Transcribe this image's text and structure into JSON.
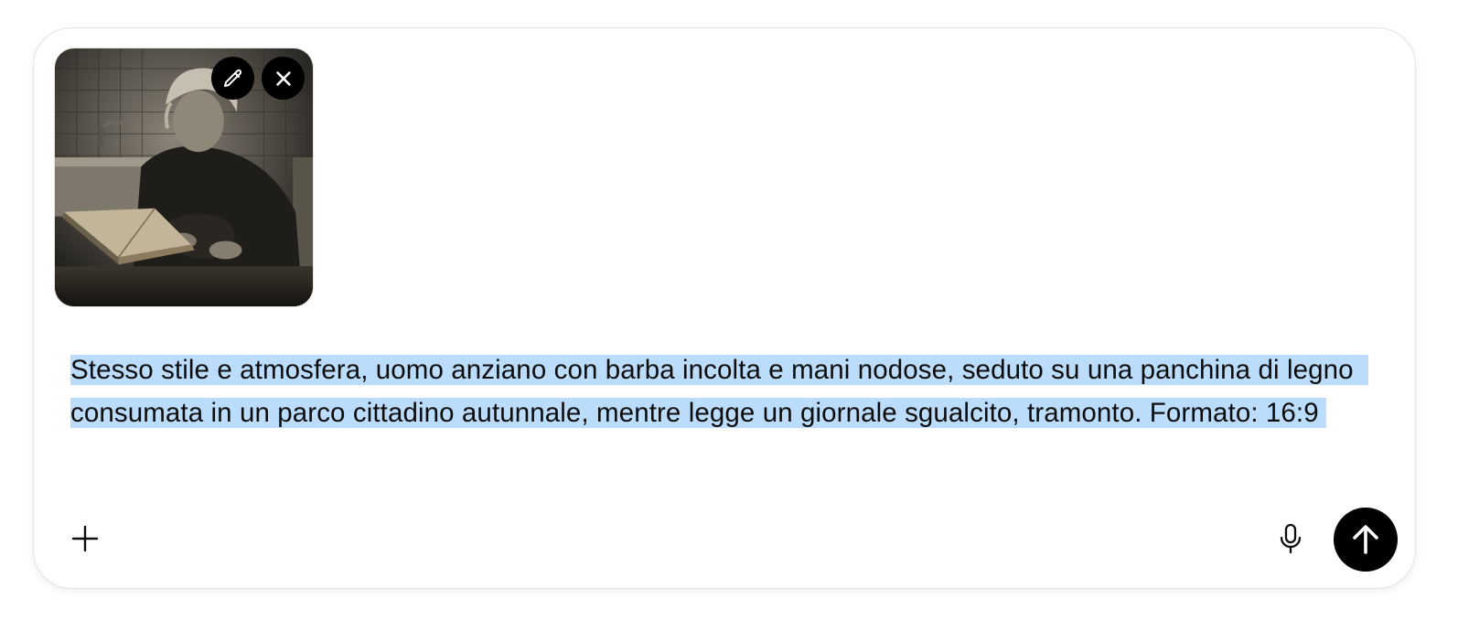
{
  "composer": {
    "attachment": {
      "alt": "Elderly woman reading a book at a kitchen table, sepia photograph",
      "edit_icon": "pencil-icon",
      "remove_icon": "close-icon"
    },
    "prompt_text": "Stesso stile e atmosfera, uomo anziano con barba incolta e mani nodose, seduto su una panchina di legno consumata in un parco cittadino autunnale, mentre legge un giornale sgualcito, tramonto. Formato: 16:9",
    "text_selected": true,
    "toolbar": {
      "add_icon": "plus-icon",
      "mic_icon": "microphone-icon",
      "send_icon": "arrow-up-icon"
    },
    "colors": {
      "selection": "#bcdcfb",
      "button_bg": "#000000",
      "border": "#e3e3e3"
    }
  }
}
